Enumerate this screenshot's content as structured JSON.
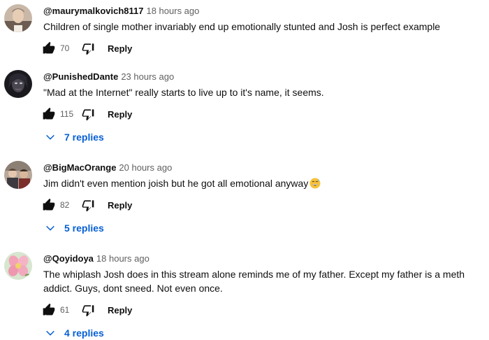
{
  "comments": [
    {
      "author": "@maurymalkovich8117",
      "time": "18 hours ago",
      "text": "Children of single mother invariably end up emotionally stunted and Josh is perfect example",
      "likes": "70",
      "reply_label": "Reply"
    },
    {
      "author": "@PunishedDante",
      "time": "23 hours ago",
      "text": "\"Mad at the Internet\" really starts to live up to it's name, it seems.",
      "likes": "115",
      "reply_label": "Reply",
      "replies_label": "7 replies"
    },
    {
      "author": "@BigMacOrange",
      "time": "20 hours ago",
      "text": "Jim didn't even mention joish but he got all emotional anyway",
      "emoji": "grinning-sweat-emoji",
      "likes": "82",
      "reply_label": "Reply",
      "replies_label": "5 replies"
    },
    {
      "author": "@Qoyidoya",
      "time": "18 hours ago",
      "text": "The whiplash Josh does in this stream alone reminds me of my father. Except my father is a meth addict.  Guys, dont sneed. Not even once.",
      "likes": "61",
      "reply_label": "Reply",
      "replies_label": "4 replies"
    }
  ],
  "colors": {
    "link": "#065fd4",
    "secondary_text": "#606060",
    "primary_text": "#0f0f0f"
  },
  "icons": [
    "thumbs-up-icon",
    "thumbs-down-icon",
    "chevron-down-icon"
  ]
}
